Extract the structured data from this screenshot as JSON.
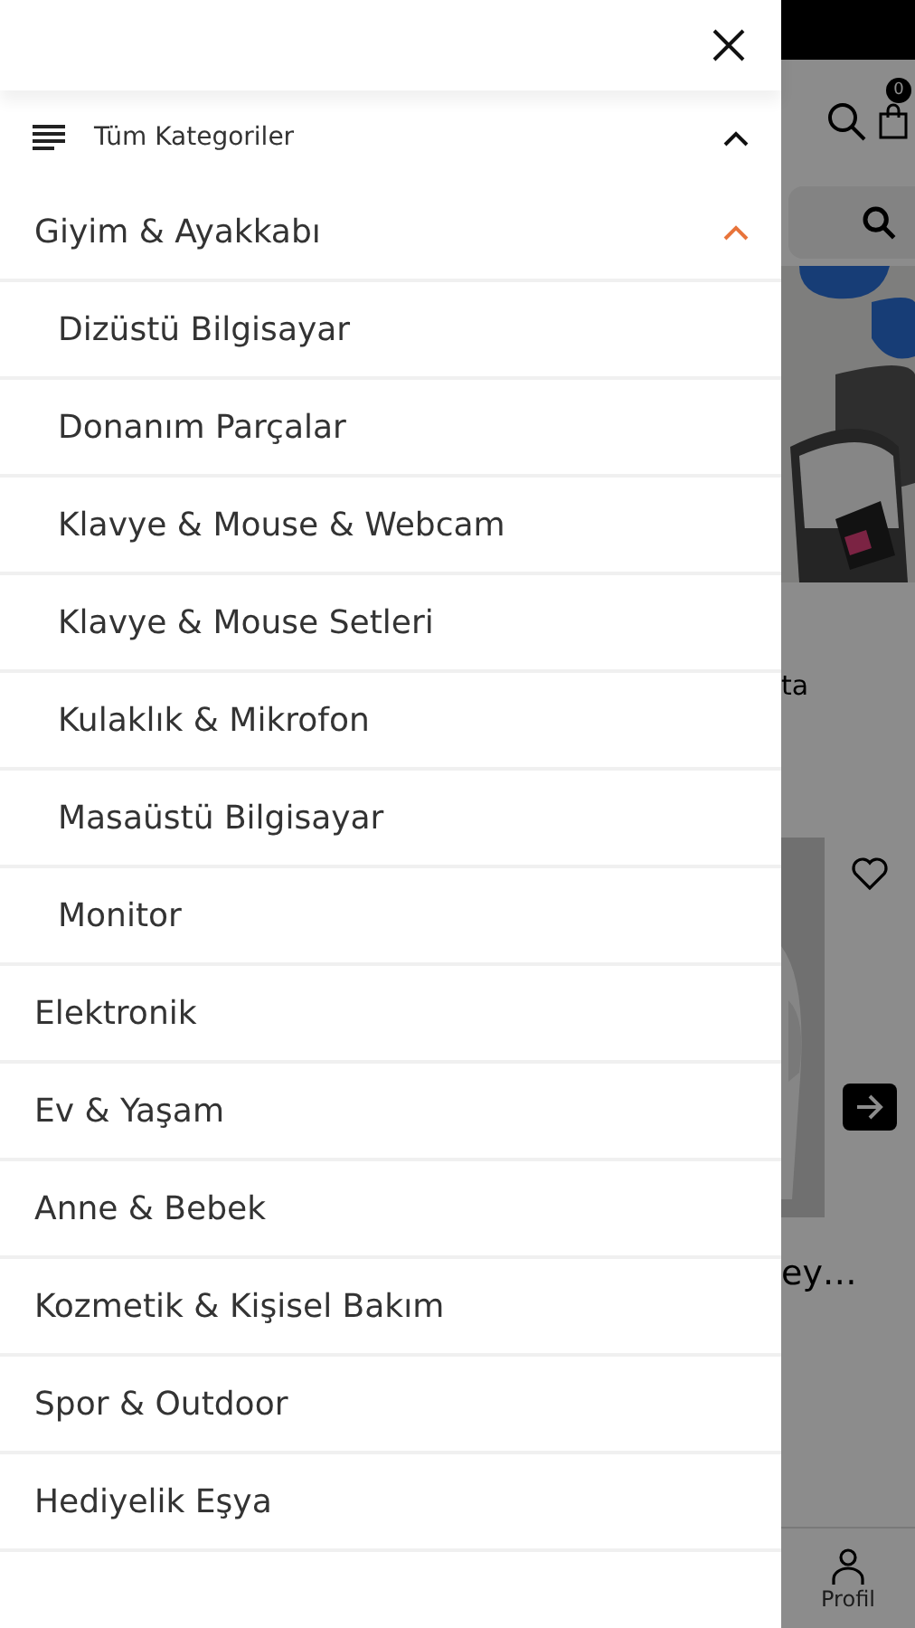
{
  "drawer": {
    "all_categories": {
      "label": "Tüm Kategoriler",
      "expanded": true
    },
    "categories": [
      {
        "label": "Giyim & Ayakkabı",
        "expanded": true,
        "children": [
          {
            "label": "Dizüstü Bilgisayar"
          },
          {
            "label": "Donanım Parçalar"
          },
          {
            "label": "Klavye & Mouse & Webcam"
          },
          {
            "label": "Klavye & Mouse Setleri"
          },
          {
            "label": "Kulaklık & Mikrofon"
          },
          {
            "label": "Masaüstü Bilgisayar"
          },
          {
            "label": "Monitor"
          }
        ]
      },
      {
        "label": "Elektronik"
      },
      {
        "label": "Ev & Yaşam"
      },
      {
        "label": "Anne & Bebek"
      },
      {
        "label": "Kozmetik & Kişisel Bakım"
      },
      {
        "label": "Spor & Outdoor"
      },
      {
        "label": "Hediyelik Eşya"
      }
    ]
  },
  "background": {
    "cart_count": "0",
    "product_text_1": "ta",
    "product_text_2": "ey…",
    "nav": [
      {
        "label": "Profil"
      }
    ]
  }
}
